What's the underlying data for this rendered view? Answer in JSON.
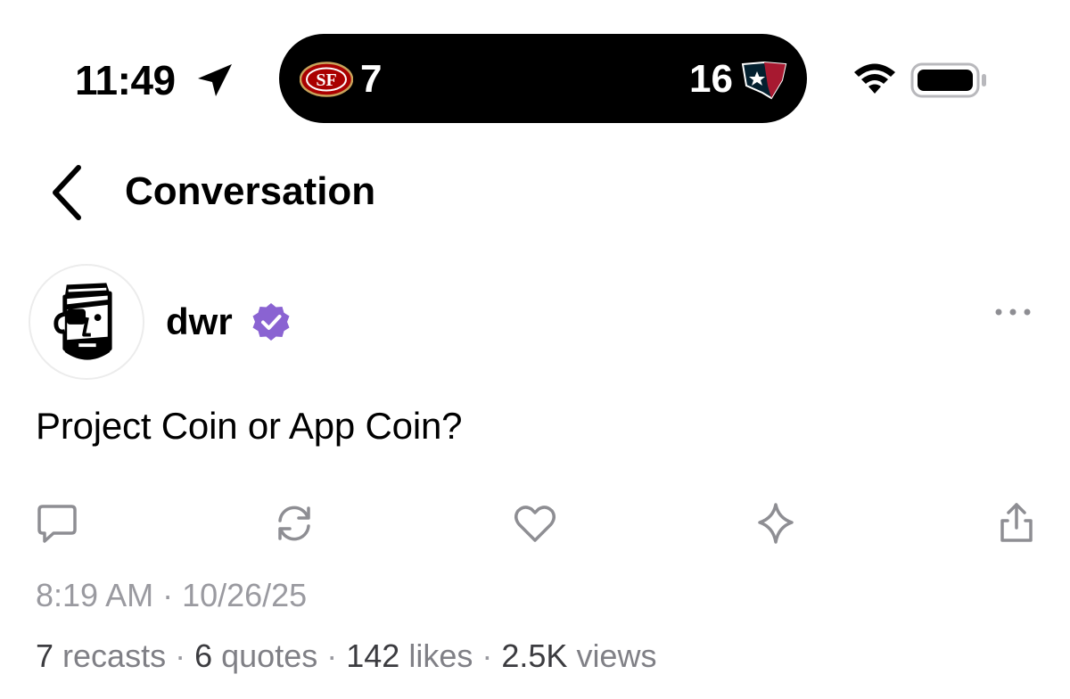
{
  "status_bar": {
    "time": "11:49",
    "score_left": "7",
    "score_right": "16",
    "left_team_icon": "49ers-logo-icon",
    "right_team_icon": "texans-logo-icon"
  },
  "nav": {
    "title": "Conversation",
    "back_icon": "chevron-left-icon"
  },
  "post": {
    "username": "dwr",
    "verified": true,
    "text": "Project Coin or App Coin?",
    "timestamp": "8:19 AM · 10/26/25",
    "stats": [
      {
        "count": "7",
        "label": "recasts"
      },
      {
        "count": "6",
        "label": "quotes"
      },
      {
        "count": "142",
        "label": "likes"
      },
      {
        "count": "2.5K",
        "label": "views"
      }
    ]
  },
  "actions": [
    "reply-icon",
    "recast-icon",
    "heart-icon",
    "sparkle-icon",
    "share-icon"
  ],
  "colors": {
    "accent_verified": "#8a63d2",
    "text_secondary": "#9a9aa0",
    "icon_gray": "#8e8e93"
  }
}
